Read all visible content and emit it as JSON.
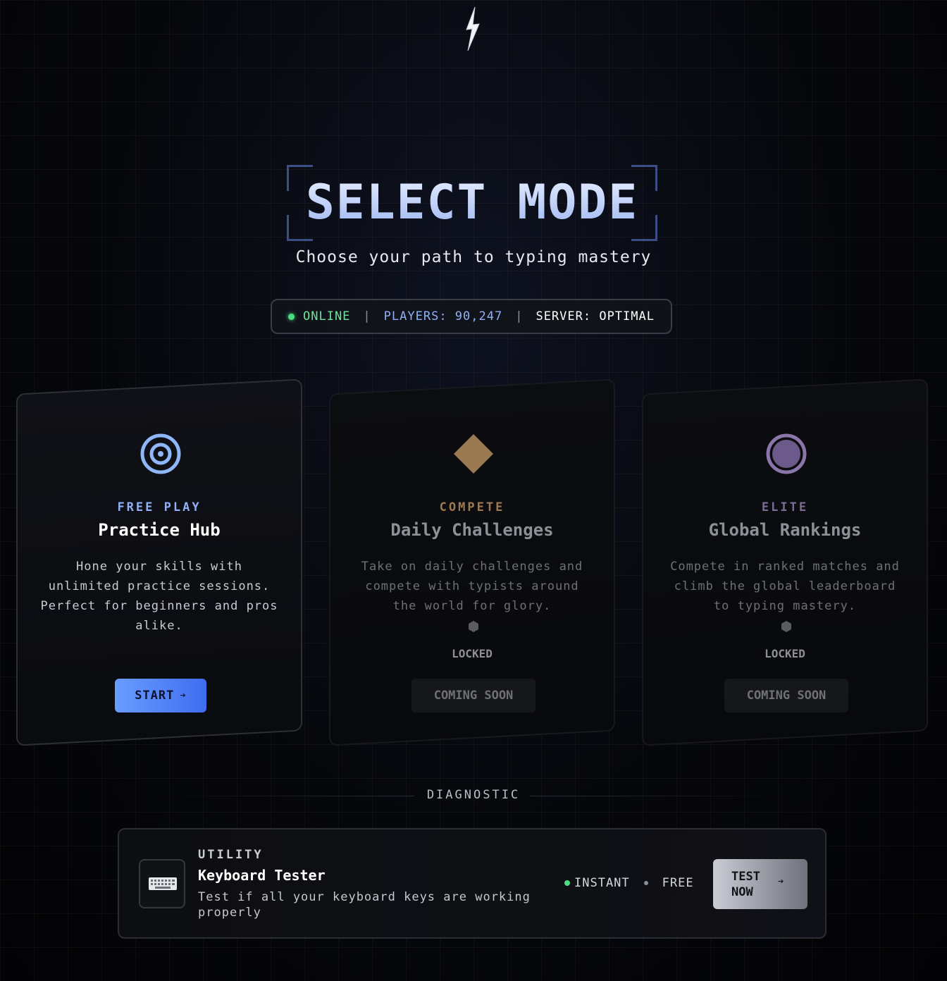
{
  "header": {
    "logo_icon": "lightning-bolt-icon",
    "title": "SELECT MODE",
    "subtitle": "Choose your path to typing mastery"
  },
  "status": {
    "online": "ONLINE",
    "players_label": "PLAYERS: 90,247",
    "server_label": "SERVER: OPTIMAL",
    "separator": "|"
  },
  "cards": [
    {
      "icon": "target-icon",
      "kicker": "FREE PLAY",
      "title": "Practice Hub",
      "desc": "Hone your skills with unlimited practice sessions. Perfect for beginners and pros alike.",
      "button": "START",
      "button_arrow": "➔",
      "accent": "#8fb0f5"
    },
    {
      "icon": "diamond-icon",
      "kicker": "COMPETE",
      "title": "Daily Challenges",
      "desc": "Take on daily challenges and compete with typists around the world for glory.",
      "locked": "LOCKED",
      "button": "COMING SOON",
      "accent": "#a7825a"
    },
    {
      "icon": "circle-icon",
      "kicker": "ELITE",
      "title": "Global Rankings",
      "desc": "Compete in ranked matches and climb the global leaderboard to typing mastery.",
      "locked": "LOCKED",
      "button": "COMING SOON",
      "accent": "#8a76a8"
    }
  ],
  "diagnostic": {
    "label": "DIAGNOSTIC"
  },
  "utility": {
    "icon": "keyboard-icon",
    "kicker": "UTILITY",
    "title": "Keyboard Tester",
    "desc": "Test if all your keyboard keys are working properly",
    "tag1": "INSTANT",
    "tag2": "FREE",
    "button": "TEST NOW",
    "button_arrow": "➔"
  }
}
